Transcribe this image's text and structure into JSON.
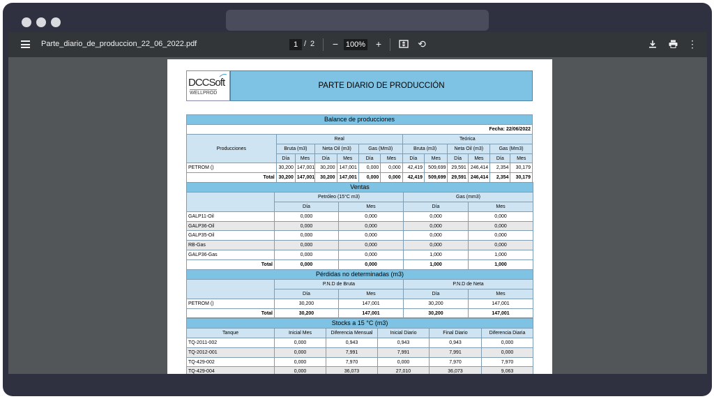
{
  "viewer": {
    "filename": "Parte_diario_de_produccion_22_06_2022.pdf",
    "page_current": "1",
    "page_sep": "/",
    "page_total": "2",
    "zoom": "100%"
  },
  "logo": {
    "brand": "DCCSoft",
    "product": "WELLPROD"
  },
  "report": {
    "title": "PARTE DIARIO DE PRODUCCIÓN"
  },
  "balance": {
    "title": "Balance de producciones",
    "fecha": "Fecha: 22/06/2022",
    "col_producciones": "Producciones",
    "real": "Real",
    "teorica": "Teórica",
    "bruta": "Bruta (m3)",
    "neta": "Neta Oil (m3)",
    "gas": "Gas (Mm3)",
    "dia": "Día",
    "mes": "Mes",
    "rows": [
      {
        "name": "PETROM ()",
        "v": [
          "30,200",
          "147,001",
          "30,200",
          "147,001",
          "0,000",
          "0,000",
          "42,419",
          "509,699",
          "29,591",
          "246,414",
          "2,354",
          "30,179"
        ]
      }
    ],
    "total": {
      "name": "Total",
      "v": [
        "30,200",
        "147,001",
        "30,200",
        "147,001",
        "0,000",
        "0,000",
        "42,419",
        "509,699",
        "29,591",
        "246,414",
        "2,354",
        "30,179"
      ]
    }
  },
  "ventas": {
    "title": "Ventas",
    "petroleo": "Petróleo (15°C m3)",
    "gas": "Gas (mm3)",
    "dia": "Día",
    "mes": "Mes",
    "rows": [
      {
        "name": "GALP11-Oil",
        "v": [
          "0,000",
          "0,000",
          "0,000",
          "0,000"
        ]
      },
      {
        "name": "GALP36-Oil",
        "v": [
          "0,000",
          "0,000",
          "0,000",
          "0,000"
        ]
      },
      {
        "name": "GALP35-Oil",
        "v": [
          "0,000",
          "0,000",
          "0,000",
          "0,000"
        ]
      },
      {
        "name": "RB-Gas",
        "v": [
          "0,000",
          "0,000",
          "0,000",
          "0,000"
        ]
      },
      {
        "name": "GALP36-Gas",
        "v": [
          "0,000",
          "0,000",
          "1,000",
          "1,000"
        ]
      }
    ],
    "total": {
      "name": "Total",
      "v": [
        "0,000",
        "0,000",
        "1,000",
        "1,000"
      ]
    }
  },
  "perdidas": {
    "title": "Pérdidas no determinadas (m3)",
    "bruta": "P.N.D de Bruta",
    "neta": "P.N.D de Neta",
    "dia": "Día",
    "mes": "Mes",
    "rows": [
      {
        "name": "PETROM ()",
        "v": [
          "30,200",
          "147,001",
          "30,200",
          "147,001"
        ]
      }
    ],
    "total": {
      "name": "Total",
      "v": [
        "30,200",
        "147,001",
        "30,200",
        "147,001"
      ]
    }
  },
  "stocks": {
    "title": "Stocks a 15 °C (m3)",
    "headers": [
      "Tanque",
      "Inicial Mes",
      "Diferencia Mensual",
      "Inicial Diario",
      "Final Diario",
      "Diferencia Diaria"
    ],
    "rows": [
      [
        "TQ-2011-002",
        "0,000",
        "0,943",
        "0,943",
        "0,943",
        "0,000"
      ],
      [
        "TQ-2012-001",
        "0,000",
        "7,991",
        "7,991",
        "7,991",
        "0,000"
      ],
      [
        "TQ-429-002",
        "0,000",
        "7,970",
        "0,000",
        "7,970",
        "7,970"
      ],
      [
        "TQ-429-004",
        "0,000",
        "36,073",
        "27,010",
        "36,073",
        "9,063"
      ]
    ]
  }
}
